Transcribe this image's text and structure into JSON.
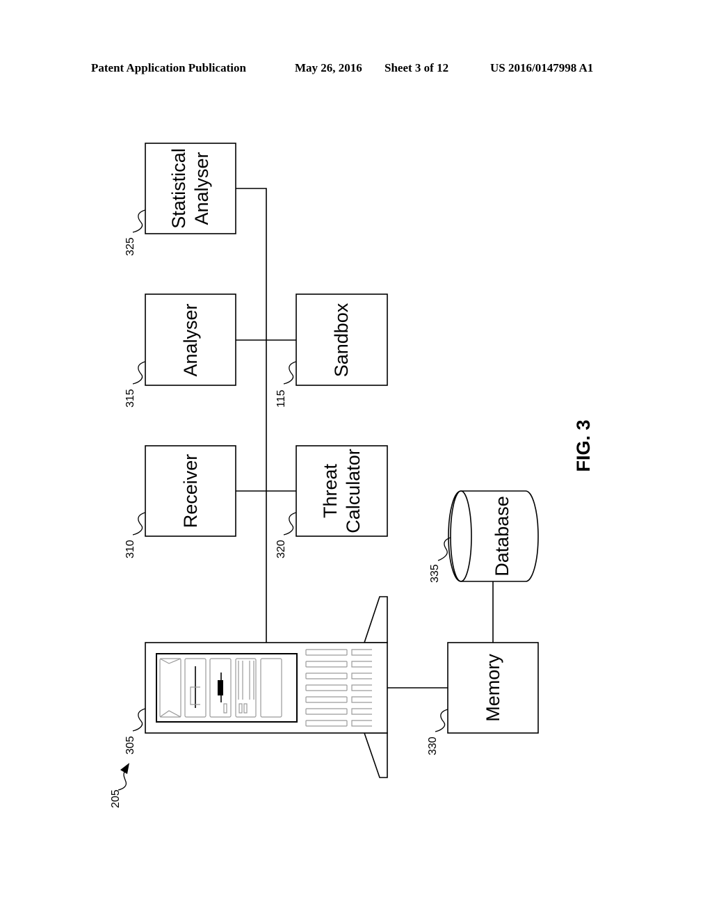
{
  "header": {
    "publication": "Patent Application Publication",
    "date": "May 26, 2016",
    "sheet": "Sheet 3 of 12",
    "number": "US 2016/0147998 A1"
  },
  "figure": {
    "title": "FIG. 3",
    "system_ref": "205",
    "server": {
      "ref": "305",
      "icon": "server-tower-icon"
    },
    "components": [
      {
        "id": "receiver",
        "label_lines": [
          "Receiver"
        ],
        "ref": "310"
      },
      {
        "id": "analyser",
        "label_lines": [
          "Analyser"
        ],
        "ref": "315"
      },
      {
        "id": "statistical-analyser",
        "label_lines": [
          "Statistical",
          "Analyser"
        ],
        "ref": "325"
      },
      {
        "id": "threat-calculator",
        "label_lines": [
          "Threat",
          "Calculator"
        ],
        "ref": "320"
      },
      {
        "id": "sandbox",
        "label_lines": [
          "Sandbox"
        ],
        "ref": "115"
      },
      {
        "id": "memory",
        "label_lines": [
          "Memory"
        ],
        "ref": "330"
      },
      {
        "id": "database",
        "label_lines": [
          "Database"
        ],
        "ref": "335",
        "shape": "cylinder-icon"
      }
    ]
  }
}
